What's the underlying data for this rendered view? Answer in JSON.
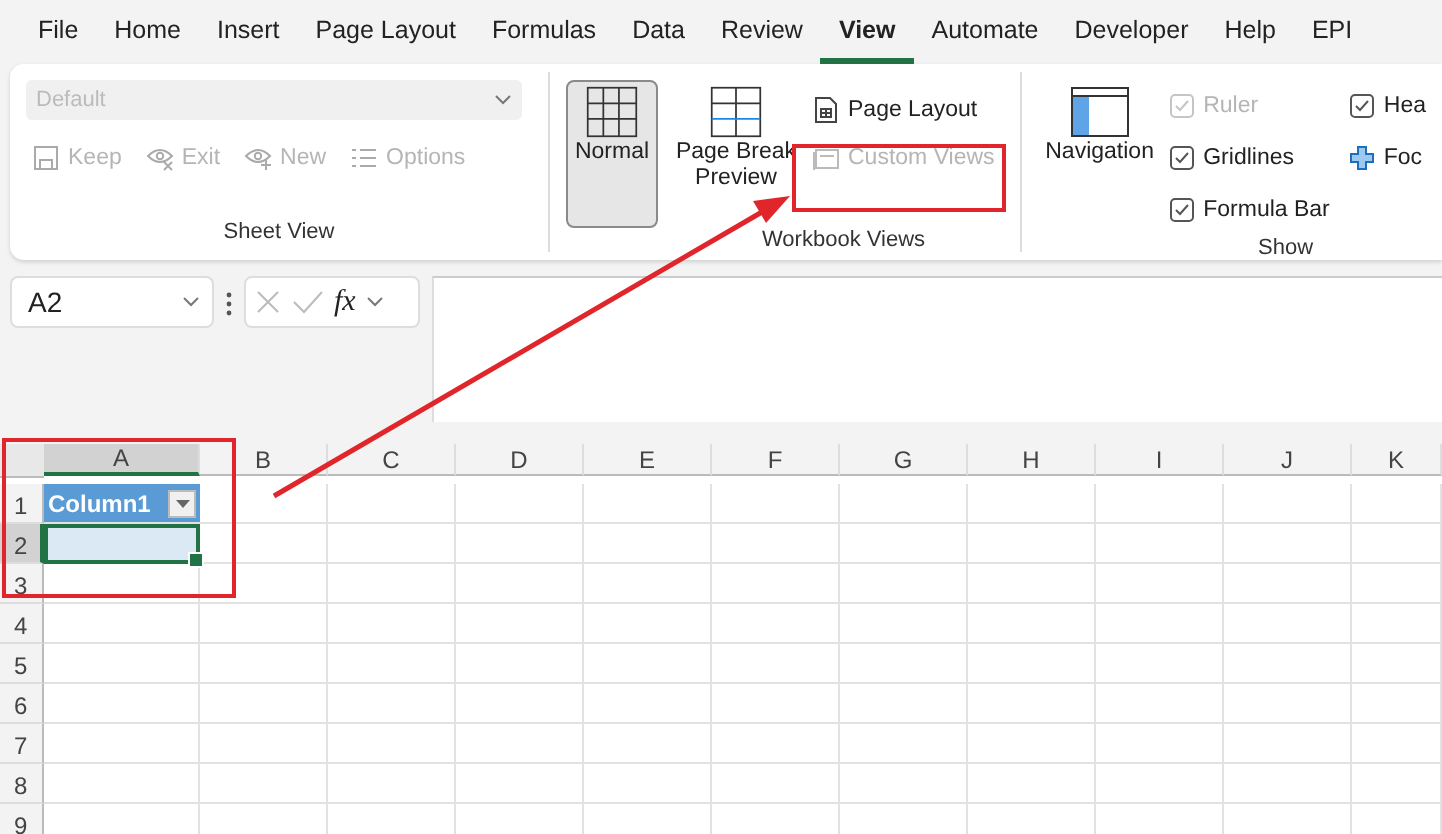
{
  "menu_tabs": [
    {
      "label": "File",
      "selected": false
    },
    {
      "label": "Home",
      "selected": false
    },
    {
      "label": "Insert",
      "selected": false
    },
    {
      "label": "Page Layout",
      "selected": false
    },
    {
      "label": "Formulas",
      "selected": false
    },
    {
      "label": "Data",
      "selected": false
    },
    {
      "label": "Review",
      "selected": false
    },
    {
      "label": "View",
      "selected": true
    },
    {
      "label": "Automate",
      "selected": false
    },
    {
      "label": "Developer",
      "selected": false
    },
    {
      "label": "Help",
      "selected": false
    },
    {
      "label": "EPI",
      "selected": false
    }
  ],
  "sheet_view": {
    "dropdown": {
      "value": "Default",
      "disabled": true
    },
    "buttons": [
      {
        "label": "Keep",
        "disabled": true
      },
      {
        "label": "Exit",
        "disabled": true
      },
      {
        "label": "New",
        "disabled": true
      },
      {
        "label": "Options",
        "disabled": true
      }
    ],
    "label": "Sheet View"
  },
  "workbook_views": {
    "large_buttons": [
      {
        "label": "Normal",
        "selected": true
      },
      {
        "label": "Page Break Preview",
        "selected": false
      }
    ],
    "small_buttons": [
      {
        "label": "Page Layout",
        "disabled": false
      },
      {
        "label": "Custom Views",
        "disabled": true
      }
    ],
    "label": "Workbook Views"
  },
  "show": {
    "navigation": {
      "label": "Navigation"
    },
    "checkboxes": [
      {
        "label": "Ruler",
        "checked": true,
        "disabled": true
      },
      {
        "label": "Gridlines",
        "checked": true,
        "disabled": false
      },
      {
        "label": "Formula Bar",
        "checked": true,
        "disabled": false
      }
    ],
    "extra": [
      {
        "kind": "checkbox",
        "label": "Hea",
        "checked": true
      },
      {
        "kind": "button",
        "label": "Foc",
        "checked": false
      }
    ],
    "label": "Show"
  },
  "formula_bar": {
    "name_box": "A2",
    "fx_label": "fx"
  },
  "grid": {
    "columns": [
      {
        "label": "A",
        "selected": true
      },
      {
        "label": "B",
        "selected": false
      },
      {
        "label": "C",
        "selected": false
      },
      {
        "label": "D",
        "selected": false
      },
      {
        "label": "E",
        "selected": false
      },
      {
        "label": "F",
        "selected": false
      },
      {
        "label": "G",
        "selected": false
      },
      {
        "label": "H",
        "selected": false
      },
      {
        "label": "I",
        "selected": false
      },
      {
        "label": "J",
        "selected": false
      },
      {
        "label": "K",
        "selected": false
      }
    ],
    "rows": [
      {
        "label": "1",
        "selected": false,
        "cells": [
          {
            "kind": "table_header",
            "text": "Column1"
          }
        ]
      },
      {
        "label": "2",
        "selected": true,
        "cells": [
          {
            "kind": "selected"
          }
        ]
      },
      {
        "label": "3",
        "selected": false
      },
      {
        "label": "4",
        "selected": false
      },
      {
        "label": "5",
        "selected": false
      },
      {
        "label": "6",
        "selected": false
      },
      {
        "label": "7",
        "selected": false
      },
      {
        "label": "8",
        "selected": false
      },
      {
        "label": "9",
        "selected": false
      }
    ]
  }
}
